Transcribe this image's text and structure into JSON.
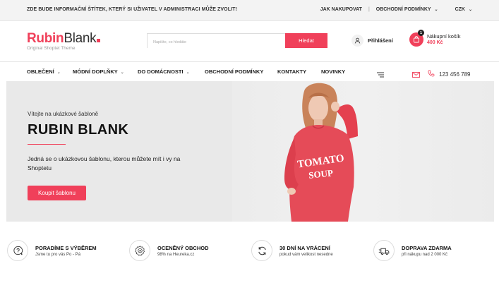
{
  "topbar": {
    "notice": "ZDE BUDE INFORMAČNÍ ŠTÍTEK, KTERÝ SI UŽIVATEL V ADMINISTRACI MŮŽE ZVOLIT!",
    "link_how": "JAK NAKUPOVAT",
    "separator": "|",
    "link_terms": "OBCHODNÍ PODMÍNKY",
    "currency": "CZK"
  },
  "header": {
    "logo_part1": "Rubin",
    "logo_part2": "Blank",
    "logo_sub": "Original Shoptet Theme",
    "search_placeholder": "Napište, co hledáte",
    "search_button": "Hledat",
    "login": "Přihlášení",
    "cart_label": "Nákupní košík",
    "cart_price": "400 Kč",
    "cart_count": "1"
  },
  "nav": {
    "items": [
      {
        "label": "OBLEČENÍ"
      },
      {
        "label": "MÓDNÍ DOPLŇKY"
      },
      {
        "label": "DO DOMÁCNOSTI"
      },
      {
        "label": "OBCHODNÍ PODMÍNKY"
      },
      {
        "label": "KONTAKTY"
      },
      {
        "label": "NOVINKY"
      }
    ],
    "phone": "123 456 789"
  },
  "hero": {
    "greeting": "Vítejte na ukázkové šabloně",
    "title": "RUBIN BLANK",
    "description": "Jedná se o ukázkovou šablonu, kterou můžete mít i vy na Shoptetu",
    "cta": "Koupit šablonu",
    "shirt_line1": "TOMATO",
    "shirt_line2": "SOUP"
  },
  "features": [
    {
      "icon": "question-bubble-icon",
      "title": "PORADÍME S VÝBĚREM",
      "subtitle": "Jsme tu pro vás Po - Pá"
    },
    {
      "icon": "award-badge-icon",
      "title": "OCENĚNÝ OBCHOD",
      "subtitle": "98% na Heureka.cz"
    },
    {
      "icon": "refresh-arrows-icon",
      "title": "30 DNÍ NA VRÁCENÍ",
      "subtitle": "pokud vám velikost nesedne"
    },
    {
      "icon": "delivery-truck-icon",
      "title": "DOPRAVA ZDARMA",
      "subtitle": "při nákupu nad 2 000 Kč"
    }
  ],
  "colors": {
    "accent": "#f0405a",
    "topbar_bg": "#f3f3f3",
    "hero_bg": "#e9e9e9",
    "text": "#222222"
  }
}
